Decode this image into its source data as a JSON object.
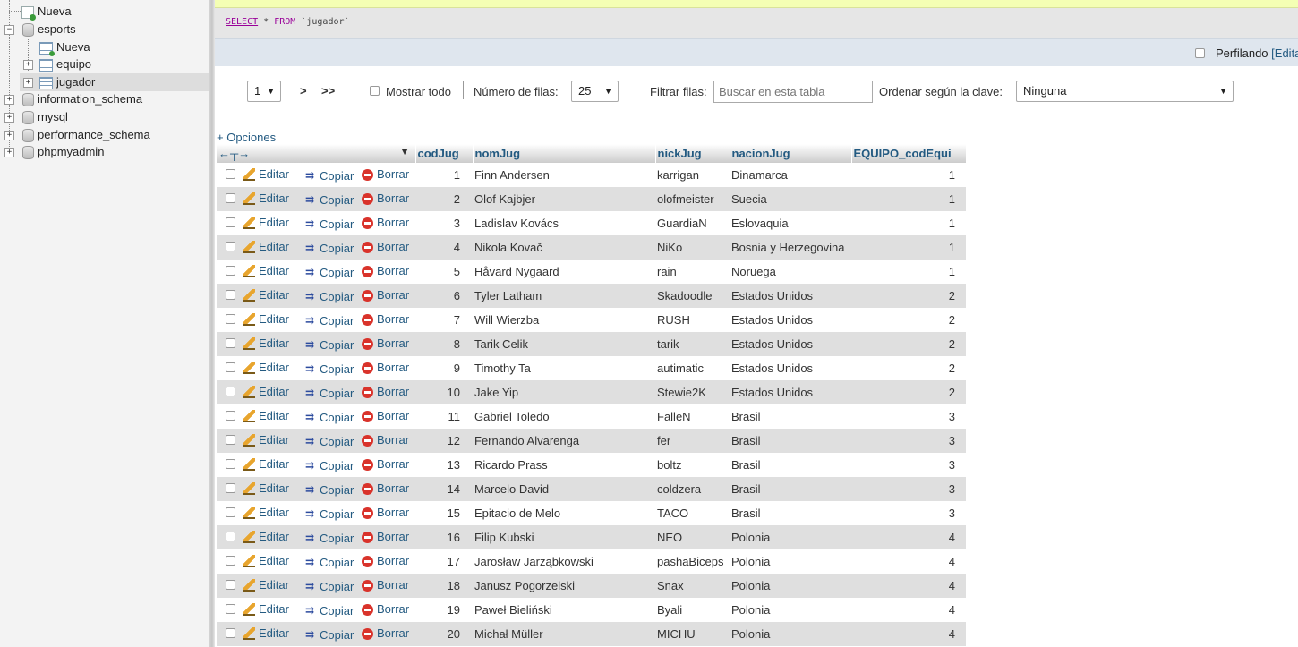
{
  "nav": {
    "items": [
      {
        "label": "Nueva",
        "icon": "new-database-icon"
      },
      {
        "label": "esports",
        "icon": "database-icon"
      },
      {
        "label": "Nueva",
        "icon": "new-table-icon"
      },
      {
        "label": "equipo",
        "icon": "table-icon"
      },
      {
        "label": "jugador",
        "icon": "table-icon"
      },
      {
        "label": "information_schema",
        "icon": "database-icon"
      },
      {
        "label": "mysql",
        "icon": "database-icon"
      },
      {
        "label": "performance_schema",
        "icon": "database-icon"
      },
      {
        "label": "phpmyadmin",
        "icon": "database-icon"
      }
    ]
  },
  "sql": {
    "select_kw": "SELECT",
    "star": "*",
    "from_kw": "FROM",
    "table": "`jugador`"
  },
  "profile": {
    "label": "Perfilando",
    "link": "[Edita"
  },
  "navbar": {
    "page_value": "1",
    "next": ">",
    "last": ">>",
    "show_all": "Mostrar todo",
    "rows_label": "Número de filas:",
    "rows_value": "25",
    "filter_label": "Filtrar filas:",
    "filter_placeholder": "Buscar en esta tabla",
    "sort_label": "Ordenar según la clave:",
    "sort_value": "Ninguna"
  },
  "options_link": "+ Opciones",
  "table": {
    "columns": [
      "codJug",
      "nomJug",
      "nickJug",
      "nacionJug",
      "EQUIPO_codEqui"
    ],
    "actions": {
      "edit": "Editar",
      "copy": "Copiar",
      "delete": "Borrar"
    },
    "rows": [
      [
        "1",
        "Finn Andersen",
        "karrigan",
        "Dinamarca",
        "1"
      ],
      [
        "2",
        "Olof Kajbjer",
        "olofmeister",
        "Suecia",
        "1"
      ],
      [
        "3",
        "Ladislav Kovács",
        "GuardiaN",
        "Eslovaquia",
        "1"
      ],
      [
        "4",
        "Nikola Kovač",
        "NiKo",
        "Bosnia y Herzegovina",
        "1"
      ],
      [
        "5",
        "Håvard Nygaard",
        "rain",
        "Noruega",
        "1"
      ],
      [
        "6",
        "Tyler Latham",
        "Skadoodle",
        "Estados Unidos",
        "2"
      ],
      [
        "7",
        "Will Wierzba",
        "RUSH",
        "Estados Unidos",
        "2"
      ],
      [
        "8",
        "Tarik Celik",
        "tarik",
        "Estados Unidos",
        "2"
      ],
      [
        "9",
        "Timothy Ta",
        "autimatic",
        "Estados Unidos",
        "2"
      ],
      [
        "10",
        "Jake Yip",
        "Stewie2K",
        "Estados Unidos",
        "2"
      ],
      [
        "11",
        "Gabriel Toledo",
        "FalleN",
        "Brasil",
        "3"
      ],
      [
        "12",
        "Fernando Alvarenga",
        "fer",
        "Brasil",
        "3"
      ],
      [
        "13",
        "Ricardo Prass",
        "boltz",
        "Brasil",
        "3"
      ],
      [
        "14",
        "Marcelo David",
        "coldzera",
        "Brasil",
        "3"
      ],
      [
        "15",
        "Epitacio de Melo",
        "TACO",
        "Brasil",
        "3"
      ],
      [
        "16",
        "Filip Kubski",
        "NEO",
        "Polonia",
        "4"
      ],
      [
        "17",
        "Jarosław Jarząbkowski",
        "pashaBiceps",
        "Polonia",
        "4"
      ],
      [
        "18",
        "Janusz Pogorzelski",
        "Snax",
        "Polonia",
        "4"
      ],
      [
        "19",
        "Paweł Bieliński",
        "Byali",
        "Polonia",
        "4"
      ],
      [
        "20",
        "Michał Müller",
        "MICHU",
        "Polonia",
        "4"
      ]
    ]
  }
}
